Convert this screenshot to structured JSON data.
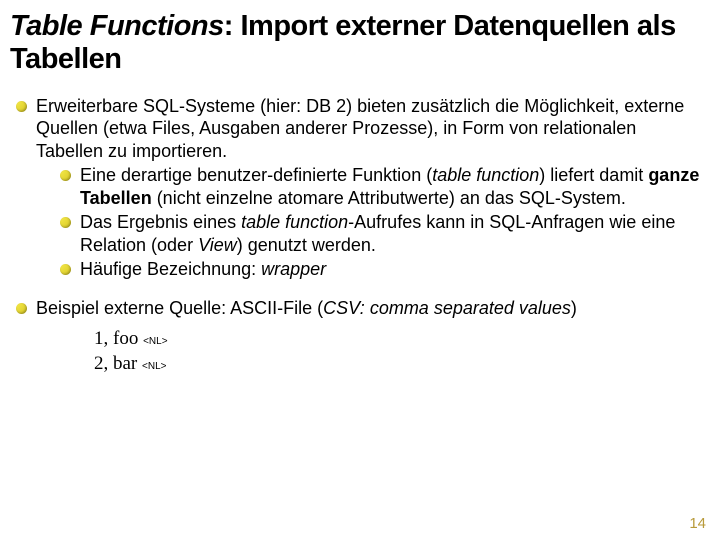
{
  "title": {
    "part1": "Table Functions",
    "part2": ": Import externer Datenquellen als Tabellen"
  },
  "bullets": {
    "b1a_1": "Erweiterbare SQL-Systeme (hier: DB 2) bieten zusätzlich die Möglichkeit, externe Quellen (etwa Files, Ausgaben anderer Prozesse), in Form von relationalen Tabellen zu importieren.",
    "b2a_1": "Eine derartige benutzer-definierte Funktion (",
    "b2a_i1": "table function",
    "b2a_2": ") liefert damit ",
    "b2a_b": "ganze Tabellen",
    "b2a_3": " (nicht einzelne atomare Attributwerte) an das SQL-System.",
    "b2b_1": "Das Ergebnis eines ",
    "b2b_i1": "table function",
    "b2b_2": "-Aufrufes kann in SQL-Anfragen wie eine Relation (oder ",
    "b2b_i2": "View",
    "b2b_3": ") genutzt werden.",
    "b2c_1": "Häufige Bezeichnung: ",
    "b2c_i1": "wrapper",
    "b1b_1": "Beispiel externe Quelle: ASCII-File (",
    "b1b_i1": "CSV: comma separated values",
    "b1b_2": ")"
  },
  "example": {
    "line1": "1, foo ",
    "line2": "2, bar ",
    "nl": "<NL>"
  },
  "page": "14"
}
